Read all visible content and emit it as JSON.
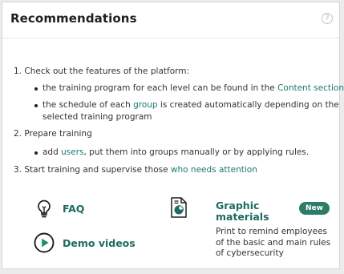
{
  "header": {
    "title": "Recommendations",
    "help_symbol": "?"
  },
  "steps": [
    {
      "number": "1.",
      "text": "Check out the features of the platform:",
      "bullets": [
        {
          "prefix": "the training program for each level can be found in the ",
          "link": "Content section",
          "suffix": ""
        },
        {
          "prefix": "the schedule of each ",
          "link": "group",
          "suffix": " is created automatically depending on the",
          "continuation": "selected training program"
        }
      ]
    },
    {
      "number": "2.",
      "text": "Prepare training",
      "bullets": [
        {
          "prefix": "add ",
          "link": "users",
          "suffix": ", put them into groups manually or by applying rules."
        }
      ]
    },
    {
      "number": "3.",
      "text": "Start training and supervise those ",
      "link": "who needs attention"
    }
  ],
  "resources": {
    "faq": {
      "label": "FAQ",
      "icon": "lightbulb-icon"
    },
    "demo": {
      "label": "Demo videos",
      "icon": "play-circle-icon"
    },
    "graphic": {
      "label": "Graphic materials",
      "icon": "document-chart-icon",
      "badge": "New",
      "description": "Print to remind employees of the basic and main rules of cybersecurity"
    }
  },
  "colors": {
    "accent": "#1e7a6d",
    "badge_bg": "#2b7d68",
    "text": "#333333"
  }
}
